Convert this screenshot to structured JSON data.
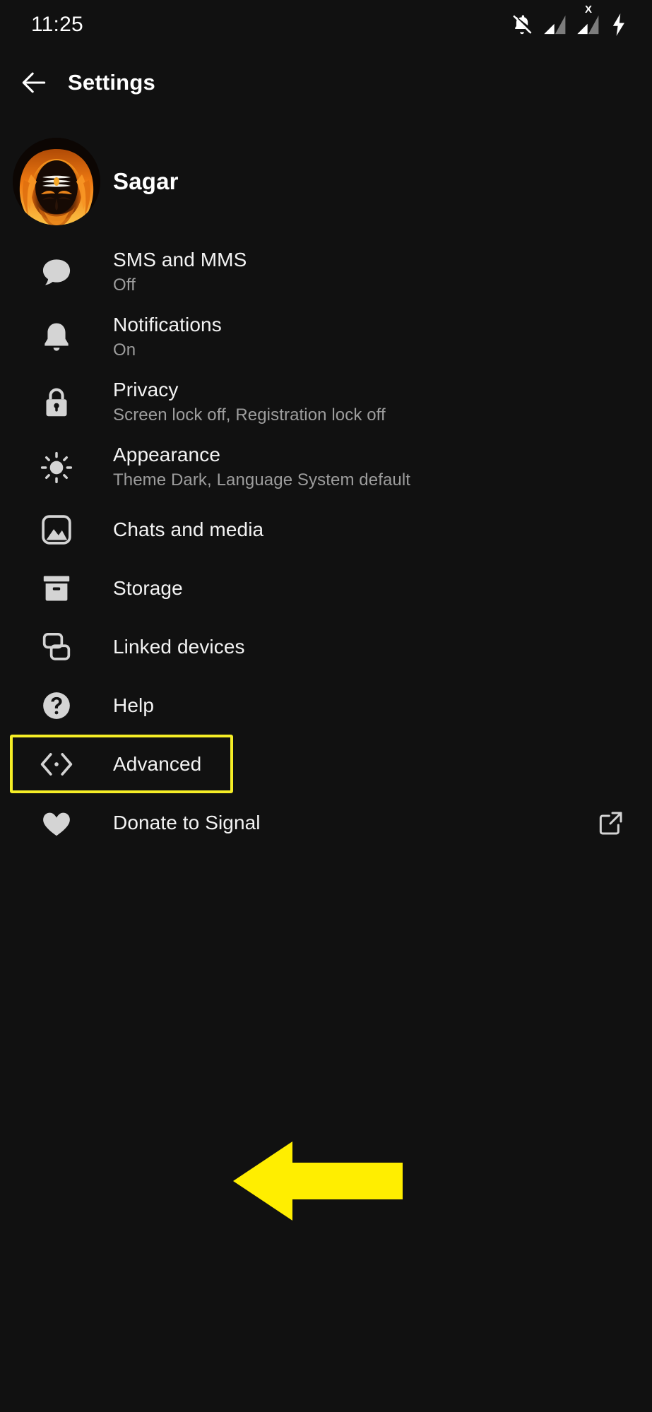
{
  "status_bar": {
    "time": "11:25",
    "icons": [
      {
        "name": "notifications-muted-icon"
      },
      {
        "name": "signal-bars-icon"
      },
      {
        "name": "signal-bars-no-sim-icon",
        "badge": "X"
      },
      {
        "name": "battery-charging-icon"
      }
    ]
  },
  "app_bar": {
    "back_icon": "back-arrow-icon",
    "title": "Settings"
  },
  "profile": {
    "avatar_icon": "user-avatar-image",
    "name": "Sagar"
  },
  "settings": [
    {
      "icon": "chat-bubble-icon",
      "label": "SMS and MMS",
      "value": "Off"
    },
    {
      "icon": "bell-icon",
      "label": "Notifications",
      "value": "On"
    },
    {
      "icon": "lock-icon",
      "label": "Privacy",
      "value": "Screen lock off, Registration lock off"
    },
    {
      "icon": "sun-icon",
      "label": "Appearance",
      "value": "Theme Dark, Language System default"
    },
    {
      "icon": "image-icon",
      "label": "Chats and media",
      "value": ""
    },
    {
      "icon": "archive-box-icon",
      "label": "Storage",
      "value": ""
    },
    {
      "icon": "linked-devices-icon",
      "label": "Linked devices",
      "value": ""
    },
    {
      "icon": "help-circle-icon",
      "label": "Help",
      "value": ""
    },
    {
      "icon": "code-brackets-icon",
      "label": "Advanced",
      "value": ""
    },
    {
      "icon": "heart-icon",
      "label": "Donate to Signal",
      "value": "",
      "trailing_icon": "external-link-icon"
    }
  ],
  "annotation": {
    "highlight_target": "Advanced",
    "highlight_color": "#f5ee26",
    "arrow_color": "#ffee00",
    "arrow_direction": "left"
  },
  "colors": {
    "background": "#111111",
    "text_primary": "#f3f3f3",
    "text_secondary": "#9d9d9d",
    "icon": "#d4d4d4",
    "highlight": "#f5ee26"
  }
}
